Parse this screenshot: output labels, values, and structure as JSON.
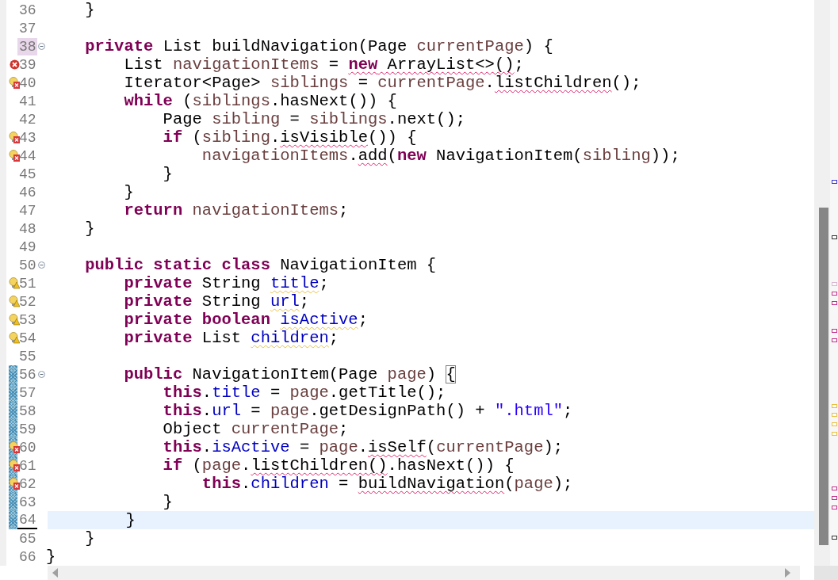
{
  "lines": [
    {
      "number": "36",
      "tokens": [
        {
          "text": "    }",
          "kind": "plain"
        }
      ],
      "changed": false,
      "current": false,
      "fold": false,
      "highlight": false
    },
    {
      "number": "37",
      "changed": false,
      "current": false,
      "fold": false,
      "highlight": false
    },
    {
      "number": "38",
      "tokens": [
        {
          "text": "    private",
          "kind": "kw"
        },
        {
          "text": " List buildNavigation(Page ",
          "kind": "plain"
        },
        {
          "text": "currentPage",
          "kind": "var"
        },
        {
          "text": ") {",
          "kind": "plain"
        }
      ],
      "changed": false,
      "current": false,
      "fold": true,
      "highlight": true
    },
    {
      "number": "39",
      "annotation": {
        "kind": "error"
      },
      "tokens": [
        {
          "text": "        List ",
          "kind": "plain"
        },
        {
          "text": "navigationItems",
          "kind": "var"
        },
        {
          "text": " = ",
          "kind": "plain"
        },
        {
          "text": "new",
          "kind": "kw",
          "underline": {
            "kind": "error"
          }
        },
        {
          "text": " ArrayList<>()",
          "kind": "plain",
          "underline": {
            "kind": "error"
          }
        },
        {
          "text": ";",
          "kind": "plain"
        }
      ],
      "changed": false,
      "current": false,
      "fold": false,
      "highlight": false
    },
    {
      "number": "40",
      "annotation": {
        "kind": "error-fix"
      },
      "tokens": [
        {
          "text": "        Iterator<Page> ",
          "kind": "plain"
        },
        {
          "text": "siblings",
          "kind": "var"
        },
        {
          "text": " = ",
          "kind": "plain"
        },
        {
          "text": "currentPage",
          "kind": "var"
        },
        {
          "text": ".",
          "kind": "plain"
        },
        {
          "text": "listChildren",
          "kind": "plain",
          "underline": {
            "kind": "error"
          }
        },
        {
          "text": "();",
          "kind": "plain"
        }
      ],
      "changed": false,
      "current": false,
      "fold": false,
      "highlight": false
    },
    {
      "number": "41",
      "tokens": [
        {
          "text": "        while",
          "kind": "kw"
        },
        {
          "text": " (",
          "kind": "plain"
        },
        {
          "text": "siblings",
          "kind": "var"
        },
        {
          "text": ".hasNext()) {",
          "kind": "plain"
        }
      ],
      "changed": false,
      "current": false,
      "fold": false,
      "highlight": false
    },
    {
      "number": "42",
      "tokens": [
        {
          "text": "            Page ",
          "kind": "plain"
        },
        {
          "text": "sibling",
          "kind": "var"
        },
        {
          "text": " = ",
          "kind": "plain"
        },
        {
          "text": "siblings",
          "kind": "var"
        },
        {
          "text": ".next();",
          "kind": "plain"
        }
      ],
      "changed": false,
      "current": false,
      "fold": false,
      "highlight": false
    },
    {
      "number": "43",
      "annotation": {
        "kind": "error-fix"
      },
      "tokens": [
        {
          "text": "            if",
          "kind": "kw"
        },
        {
          "text": " (",
          "kind": "plain"
        },
        {
          "text": "sibling",
          "kind": "var"
        },
        {
          "text": ".",
          "kind": "plain"
        },
        {
          "text": "isVisible",
          "kind": "plain",
          "underline": {
            "kind": "error"
          }
        },
        {
          "text": "()) {",
          "kind": "plain"
        }
      ],
      "changed": false,
      "current": false,
      "fold": false,
      "highlight": false
    },
    {
      "number": "44",
      "annotation": {
        "kind": "error-fix"
      },
      "tokens": [
        {
          "text": "                navigationItems",
          "kind": "var"
        },
        {
          "text": ".",
          "kind": "plain"
        },
        {
          "text": "add",
          "kind": "plain",
          "underline": {
            "kind": "error"
          }
        },
        {
          "text": "(",
          "kind": "plain"
        },
        {
          "text": "new",
          "kind": "kw"
        },
        {
          "text": " NavigationItem(",
          "kind": "plain"
        },
        {
          "text": "sibling",
          "kind": "var"
        },
        {
          "text": "));",
          "kind": "plain"
        }
      ],
      "changed": false,
      "current": false,
      "fold": false,
      "highlight": false
    },
    {
      "number": "45",
      "tokens": [
        {
          "text": "            }",
          "kind": "plain"
        }
      ],
      "changed": false,
      "current": false,
      "fold": false,
      "highlight": false
    },
    {
      "number": "46",
      "tokens": [
        {
          "text": "        }",
          "kind": "plain"
        }
      ],
      "changed": false,
      "current": false,
      "fold": false,
      "highlight": false
    },
    {
      "number": "47",
      "tokens": [
        {
          "text": "        return",
          "kind": "kw"
        },
        {
          "text": " navigationItems",
          "kind": "var"
        },
        {
          "text": ";",
          "kind": "plain"
        }
      ],
      "changed": false,
      "current": false,
      "fold": false,
      "highlight": false
    },
    {
      "number": "48",
      "tokens": [
        {
          "text": "    }",
          "kind": "plain"
        }
      ],
      "changed": false,
      "current": false,
      "fold": false,
      "highlight": false
    },
    {
      "number": "49",
      "changed": false,
      "current": false,
      "fold": false,
      "highlight": false
    },
    {
      "number": "50",
      "tokens": [
        {
          "text": "    public static class",
          "kind": "kw"
        },
        {
          "text": " NavigationItem {",
          "kind": "plain"
        }
      ],
      "changed": false,
      "current": false,
      "fold": true,
      "highlight": false
    },
    {
      "number": "51",
      "annotation": {
        "kind": "warning-fix"
      },
      "tokens": [
        {
          "text": "        private",
          "kind": "kw"
        },
        {
          "text": " String ",
          "kind": "plain"
        },
        {
          "text": "title",
          "kind": "field",
          "underline": {
            "kind": "warning"
          }
        },
        {
          "text": ";",
          "kind": "plain"
        }
      ],
      "changed": false,
      "current": false,
      "fold": false,
      "highlight": false
    },
    {
      "number": "52",
      "annotation": {
        "kind": "warning-fix"
      },
      "tokens": [
        {
          "text": "        private",
          "kind": "kw"
        },
        {
          "text": " String ",
          "kind": "plain"
        },
        {
          "text": "url",
          "kind": "field",
          "underline": {
            "kind": "warning"
          }
        },
        {
          "text": ";",
          "kind": "plain"
        }
      ],
      "changed": false,
      "current": false,
      "fold": false,
      "highlight": false
    },
    {
      "number": "53",
      "annotation": {
        "kind": "warning-fix"
      },
      "tokens": [
        {
          "text": "        private boolean ",
          "kind": "kw"
        },
        {
          "text": "isActive",
          "kind": "field",
          "underline": {
            "kind": "warning"
          }
        },
        {
          "text": ";",
          "kind": "plain"
        }
      ],
      "changed": false,
      "current": false,
      "fold": false,
      "highlight": false
    },
    {
      "number": "54",
      "annotation": {
        "kind": "warning-fix"
      },
      "tokens": [
        {
          "text": "        private",
          "kind": "kw"
        },
        {
          "text": " List ",
          "kind": "plain"
        },
        {
          "text": "children",
          "kind": "field",
          "underline": {
            "kind": "warning"
          }
        },
        {
          "text": ";",
          "kind": "plain"
        }
      ],
      "changed": false,
      "current": false,
      "fold": false,
      "highlight": false
    },
    {
      "number": "55",
      "changed": false,
      "current": false,
      "fold": false,
      "highlight": false
    },
    {
      "number": "56",
      "tokens": [
        {
          "text": "        public",
          "kind": "kw"
        },
        {
          "text": " NavigationItem(Page ",
          "kind": "plain"
        },
        {
          "text": "page",
          "kind": "var"
        },
        {
          "text": ") ",
          "kind": "plain"
        },
        {
          "text": "{",
          "kind": "bracket-match"
        }
      ],
      "changed": true,
      "current": false,
      "fold": true,
      "highlight": false
    },
    {
      "number": "57",
      "tokens": [
        {
          "text": "            this",
          "kind": "kw"
        },
        {
          "text": ".",
          "kind": "plain"
        },
        {
          "text": "title",
          "kind": "field"
        },
        {
          "text": " = ",
          "kind": "plain"
        },
        {
          "text": "page",
          "kind": "var"
        },
        {
          "text": ".getTitle();",
          "kind": "plain"
        }
      ],
      "changed": true,
      "current": false,
      "fold": false,
      "highlight": false
    },
    {
      "number": "58",
      "tokens": [
        {
          "text": "            this",
          "kind": "kw"
        },
        {
          "text": ".",
          "kind": "plain"
        },
        {
          "text": "url",
          "kind": "field"
        },
        {
          "text": " = ",
          "kind": "plain"
        },
        {
          "text": "page",
          "kind": "var"
        },
        {
          "text": ".getDesignPath() + ",
          "kind": "plain"
        },
        {
          "text": "\".html\"",
          "kind": "str"
        },
        {
          "text": ";",
          "kind": "plain"
        }
      ],
      "changed": true,
      "current": false,
      "fold": false,
      "highlight": false
    },
    {
      "number": "59",
      "tokens": [
        {
          "text": "            Object ",
          "kind": "plain"
        },
        {
          "text": "currentPage",
          "kind": "var"
        },
        {
          "text": ";",
          "kind": "plain"
        }
      ],
      "changed": true,
      "current": false,
      "fold": false,
      "highlight": false
    },
    {
      "number": "60",
      "annotation": {
        "kind": "error-fix"
      },
      "tokens": [
        {
          "text": "            this",
          "kind": "kw"
        },
        {
          "text": ".",
          "kind": "plain"
        },
        {
          "text": "isActive",
          "kind": "field"
        },
        {
          "text": " = ",
          "kind": "plain"
        },
        {
          "text": "page",
          "kind": "var"
        },
        {
          "text": ".",
          "kind": "plain"
        },
        {
          "text": "isSelf",
          "kind": "plain",
          "underline": {
            "kind": "error"
          }
        },
        {
          "text": "(",
          "kind": "plain"
        },
        {
          "text": "currentPage",
          "kind": "var"
        },
        {
          "text": ");",
          "kind": "plain"
        }
      ],
      "changed": true,
      "current": false,
      "fold": false,
      "highlight": false
    },
    {
      "number": "61",
      "annotation": {
        "kind": "error-fix"
      },
      "tokens": [
        {
          "text": "            if",
          "kind": "kw"
        },
        {
          "text": " (",
          "kind": "plain"
        },
        {
          "text": "page",
          "kind": "var"
        },
        {
          "text": ".",
          "kind": "plain"
        },
        {
          "text": "listChildren()",
          "kind": "plain",
          "underline": {
            "kind": "error"
          }
        },
        {
          "text": ".hasNext()) {",
          "kind": "plain"
        }
      ],
      "changed": true,
      "current": false,
      "fold": false,
      "highlight": false
    },
    {
      "number": "62",
      "annotation": {
        "kind": "error-fix"
      },
      "tokens": [
        {
          "text": "                this",
          "kind": "kw"
        },
        {
          "text": ".",
          "kind": "plain"
        },
        {
          "text": "children",
          "kind": "field"
        },
        {
          "text": " = ",
          "kind": "plain"
        },
        {
          "text": "buildNavigation",
          "kind": "plain",
          "underline": {
            "kind": "error"
          }
        },
        {
          "text": "(",
          "kind": "plain"
        },
        {
          "text": "page",
          "kind": "var"
        },
        {
          "text": ");",
          "kind": "plain"
        }
      ],
      "changed": true,
      "current": false,
      "fold": false,
      "highlight": false
    },
    {
      "number": "63",
      "tokens": [
        {
          "text": "            }",
          "kind": "plain"
        }
      ],
      "changed": true,
      "current": false,
      "fold": false,
      "highlight": false
    },
    {
      "number": "64",
      "tokens": [
        {
          "text": "        }",
          "kind": "plain"
        }
      ],
      "changed": true,
      "current": true,
      "fold": false,
      "highlight": false
    },
    {
      "number": "65",
      "tokens": [
        {
          "text": "    }",
          "kind": "plain"
        }
      ],
      "changed": false,
      "current": false,
      "fold": false,
      "highlight": false
    },
    {
      "number": "66",
      "tokens": [
        {
          "text": "}",
          "kind": "plain"
        }
      ],
      "changed": false,
      "current": false,
      "fold": false,
      "highlight": false
    }
  ]
}
